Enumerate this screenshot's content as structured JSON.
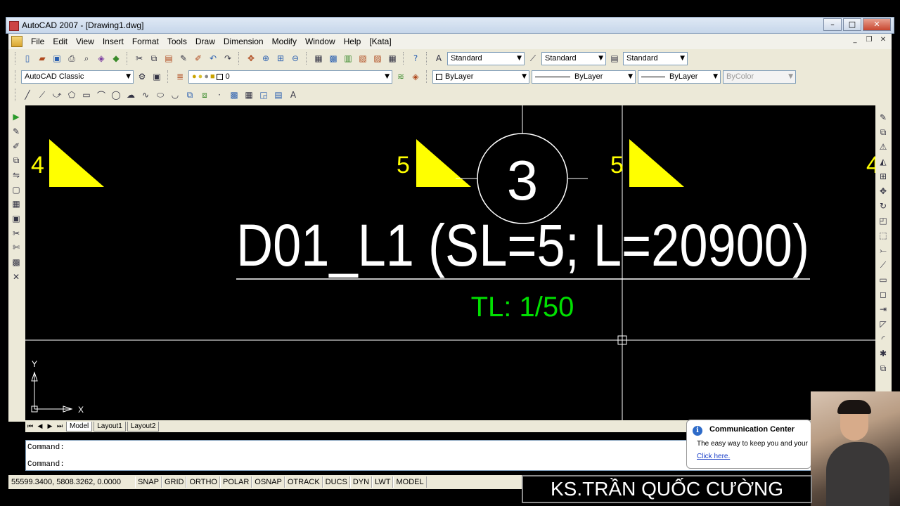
{
  "window": {
    "title": "AutoCAD 2007 - [Drawing1.dwg]",
    "controls": [
      "–",
      "□",
      "✕"
    ]
  },
  "menubar": {
    "items": [
      "File",
      "Edit",
      "View",
      "Insert",
      "Format",
      "Tools",
      "Draw",
      "Dimension",
      "Modify",
      "Window",
      "Help",
      "[Kata]"
    ],
    "mdi_controls": [
      "_",
      "❐",
      "✕"
    ]
  },
  "styles_toolbar": {
    "text_style": "Standard",
    "dim_style": "Standard",
    "table_style": "Standard"
  },
  "workspace_toolbar": {
    "workspace": "AutoCAD Classic",
    "layer": "0",
    "color": "ByLayer",
    "linetype": "ByLayer",
    "lineweight": "ByLayer",
    "plot_style": "ByColor"
  },
  "drawing": {
    "bubble_number": "3",
    "main_text": "D01_L1 (SL=5; L=20900)",
    "scale_text": "TL: 1/50",
    "markers": [
      "4",
      "5",
      "5",
      "4"
    ],
    "ucs_x": "X",
    "ucs_y": "Y",
    "colors": {
      "white": "#ffffff",
      "yellow": "#ffff00",
      "green": "#00e000"
    }
  },
  "layout_tabs": [
    "Model",
    "Layout1",
    "Layout2"
  ],
  "command_line": {
    "line1": "Command:",
    "line2": "Command:"
  },
  "status_bar": {
    "coordinates": "55599.3400, 5808.3262, 0.0000",
    "toggles": [
      "SNAP",
      "GRID",
      "ORTHO",
      "POLAR",
      "OSNAP",
      "OTRACK",
      "DUCS",
      "DYN",
      "LWT",
      "MODEL"
    ]
  },
  "communication_center": {
    "title": "Communication Center",
    "body": "The easy way to keep you and your",
    "link": "Click here."
  },
  "watermark": "KS.TRẦN QUỐC CƯỜNG"
}
